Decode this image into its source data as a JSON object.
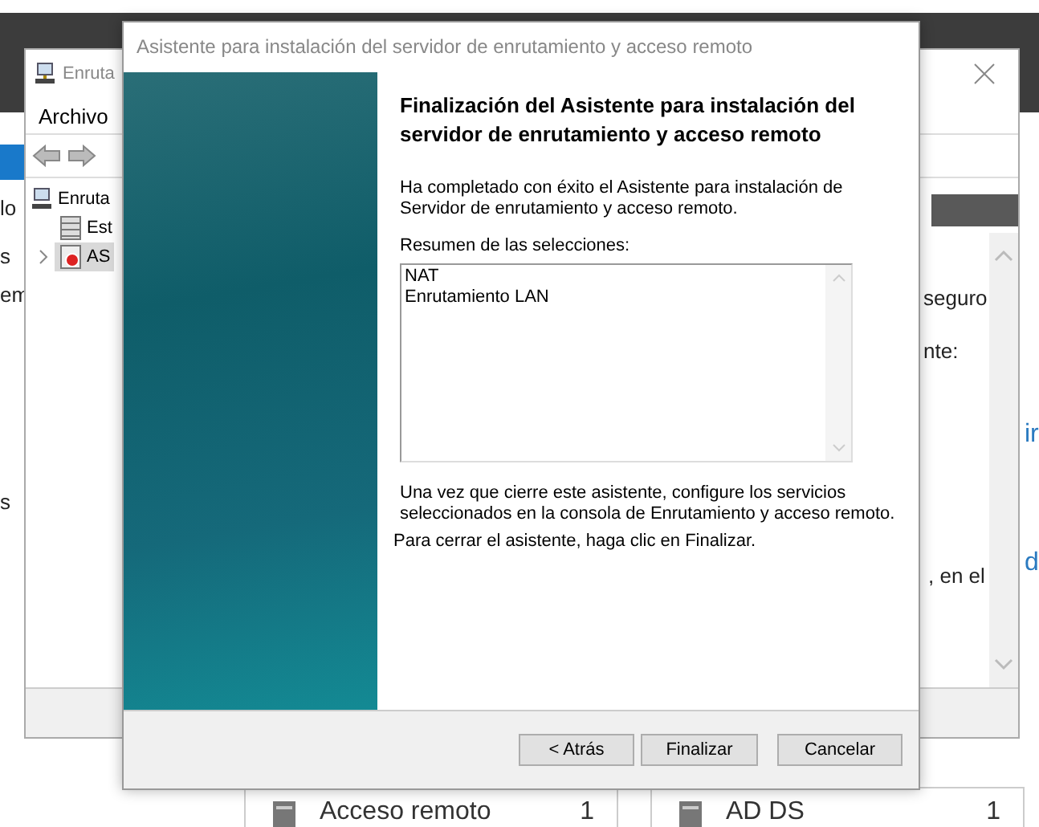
{
  "background_window": {
    "left_fragments": [
      "lo",
      "s",
      "em",
      "s"
    ],
    "right_fragments": [
      {
        "text": "seguro",
        "kind": "plain"
      },
      {
        "text": "nte:",
        "kind": "plain"
      },
      {
        "text": "ir",
        "kind": "link"
      },
      {
        "text": "d",
        "kind": "link"
      },
      {
        "text": ", en el",
        "kind": "plain"
      }
    ],
    "tiles": [
      {
        "name": "Acceso remoto",
        "count": "1"
      },
      {
        "name": "AD DS",
        "count": "1"
      }
    ]
  },
  "console_window": {
    "title": "Enruta",
    "menu": [
      "Archivo"
    ],
    "tree": [
      {
        "label": "Enruta",
        "children": [
          {
            "label": "Est",
            "kind": "database",
            "expandable": false,
            "selected": false
          },
          {
            "label": "AS",
            "kind": "server",
            "expandable": true,
            "selected": true
          }
        ]
      }
    ]
  },
  "wizard": {
    "title": "Asistente para instalación del servidor de enrutamiento y acceso remoto",
    "heading": "Finalización del Asistente para instalación del servidor de enrutamiento y acceso remoto",
    "intro": "Ha completado con éxito el Asistente para instalación de Servidor de enrutamiento y acceso remoto.",
    "summary_label": "Resumen de las selecciones:",
    "summary_items": [
      "NAT",
      "Enrutamiento LAN"
    ],
    "note": "Una vez que cierre este asistente, configure los servicios seleccionados en la consola de Enrutamiento y acceso remoto.",
    "closing": "Para cerrar el asistente, haga clic en Finalizar.",
    "buttons": [
      {
        "label": "< Atrás",
        "kind": "back"
      },
      {
        "label": "Finalizar",
        "kind": "finish"
      },
      {
        "label": "Cancelar",
        "kind": "cancel"
      }
    ]
  }
}
